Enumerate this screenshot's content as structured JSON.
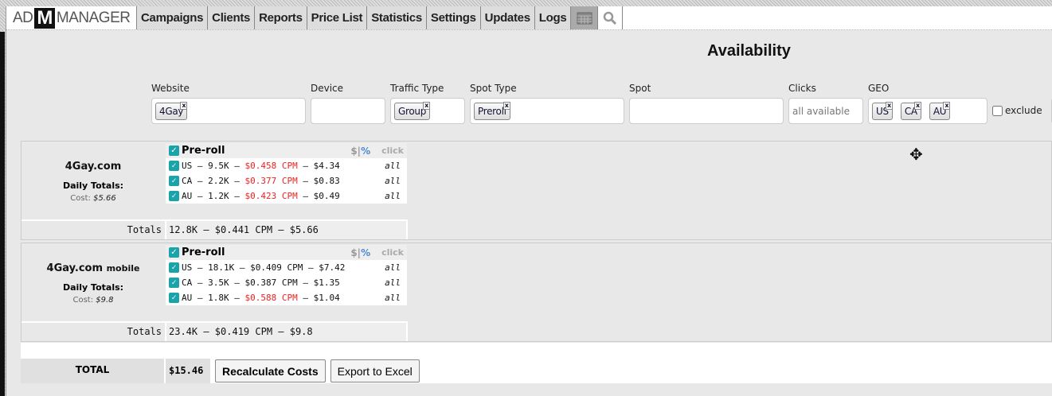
{
  "nav": {
    "logo": "AD M MANAGER",
    "logo_left": "AD",
    "logo_mid": "M",
    "logo_right": "MANAGER",
    "tabs": [
      "Campaigns",
      "Clients",
      "Reports",
      "Price List",
      "Statistics",
      "Settings",
      "Updates",
      "Logs"
    ],
    "icons": [
      "calendar-icon",
      "search-zoom-icon"
    ]
  },
  "title": "Availability",
  "filters": {
    "website": {
      "label": "Website",
      "chips": [
        "4Gay"
      ]
    },
    "device": {
      "label": "Device"
    },
    "traffic_type": {
      "label": "Traffic Type",
      "chips": [
        "Group"
      ]
    },
    "spot_type": {
      "label": "Spot Type",
      "chips": [
        "Preroll"
      ]
    },
    "spot": {
      "label": "Spot"
    },
    "clicks": {
      "label": "Clicks",
      "placeholder": "all available"
    },
    "geo": {
      "label": "GEO",
      "chips": [
        "US",
        "CA",
        "AU"
      ]
    },
    "exclude_label": "exclude",
    "exclude_checked": false
  },
  "sites": [
    {
      "name": "4Gay.com",
      "suffix": "",
      "daily_totals": "Daily Totals:",
      "cost_label": "Cost:",
      "cost": "$5.66",
      "spot": "Pre-roll",
      "dollar": "$",
      "percent": "%",
      "click": "click",
      "rows": [
        {
          "geo": "US",
          "imps": "9.5K",
          "cpm": "$0.458 CPM",
          "cpm_red": true,
          "cost": "$4.34",
          "clicks": "all"
        },
        {
          "geo": "CA",
          "imps": "2.2K",
          "cpm": "$0.377 CPM",
          "cpm_red": true,
          "cost": "$0.83",
          "clicks": "all"
        },
        {
          "geo": "AU",
          "imps": "1.2K",
          "cpm": "$0.423 CPM",
          "cpm_red": true,
          "cost": "$0.49",
          "clicks": "all"
        }
      ],
      "totals_label": "Totals",
      "totals": "12.8K – $0.441 CPM – $5.66"
    },
    {
      "name": "4Gay.com",
      "suffix": "mobile",
      "daily_totals": "Daily Totals:",
      "cost_label": "Cost:",
      "cost": "$9.8",
      "spot": "Pre-roll",
      "dollar": "$",
      "percent": "%",
      "click": "click",
      "rows": [
        {
          "geo": "US",
          "imps": "18.1K",
          "cpm": "$0.409 CPM",
          "cpm_red": false,
          "cost": "$7.42",
          "clicks": "all"
        },
        {
          "geo": "CA",
          "imps": "3.5K",
          "cpm": "$0.387 CPM",
          "cpm_red": false,
          "cost": "$1.35",
          "clicks": "all"
        },
        {
          "geo": "AU",
          "imps": "1.8K",
          "cpm": "$0.588 CPM",
          "cpm_red": true,
          "cost": "$1.04",
          "clicks": "all"
        }
      ],
      "totals_label": "Totals",
      "totals": "23.4K – $0.419 CPM – $9.8"
    }
  ],
  "total": {
    "label": "TOTAL",
    "value": "$15.46",
    "recalc": "Recalculate Costs",
    "export": "Export to Excel"
  },
  "colors": {
    "checkbox": "#1aa3a8",
    "cpm_red": "#ee2222",
    "percent": "#4a8ad4"
  }
}
